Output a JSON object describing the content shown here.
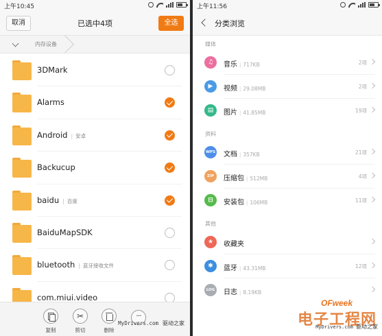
{
  "left": {
    "status": {
      "time": "上午10:45"
    },
    "header": {
      "cancel": "取消",
      "title": "已选中4项",
      "select_all": "全选"
    },
    "breadcrumb": {
      "segment": "内存设备"
    },
    "folders": [
      {
        "name": "3DMark",
        "desc": "",
        "checked": false
      },
      {
        "name": "Alarms",
        "desc": "",
        "checked": true
      },
      {
        "name": "Android",
        "desc": "安卓",
        "checked": true
      },
      {
        "name": "Backucup",
        "desc": "",
        "checked": true
      },
      {
        "name": "baidu",
        "desc": "百度",
        "checked": true
      },
      {
        "name": "BaiduMapSDK",
        "desc": "",
        "checked": false
      },
      {
        "name": "bluetooth",
        "desc": "蓝牙接收文件",
        "checked": false
      },
      {
        "name": "com.miui.video",
        "desc": "",
        "checked": false
      }
    ],
    "actions": {
      "copy": "复制",
      "cut": "剪切",
      "delete": "删除"
    },
    "watermark": {
      "site": "MyDrivers.com",
      "name": "驱动之家"
    }
  },
  "right": {
    "status": {
      "time": "上午11:56"
    },
    "header": {
      "title": "分类浏览"
    },
    "sections": [
      {
        "title": "媒体",
        "items": [
          {
            "name": "音乐",
            "size": "717KB",
            "count": "2项",
            "icon": "music-icon",
            "color": "#ec6f9f",
            "glyph": "♫"
          },
          {
            "name": "视频",
            "size": "29.08MB",
            "count": "2项",
            "icon": "video-icon",
            "color": "#4a9be6",
            "glyph": "▶"
          },
          {
            "name": "图片",
            "size": "41.85MB",
            "count": "19项",
            "icon": "image-icon",
            "color": "#35b98a",
            "glyph": "▤"
          }
        ]
      },
      {
        "title": "资料",
        "items": [
          {
            "name": "文档",
            "size": "357KB",
            "count": "21项",
            "icon": "document-icon",
            "color": "#4d8fe8",
            "glyph": "WPS"
          },
          {
            "name": "压缩包",
            "size": "512MB",
            "count": "4项",
            "icon": "archive-icon",
            "color": "#f0a35e",
            "glyph": "ZIP"
          },
          {
            "name": "安装包",
            "size": "106MB",
            "count": "11项",
            "icon": "apk-icon",
            "color": "#55bb4a",
            "glyph": "⊟"
          }
        ]
      },
      {
        "title": "其他",
        "items": [
          {
            "name": "收藏夹",
            "size": "",
            "count": "",
            "icon": "favorites-icon",
            "color": "#ee6757",
            "glyph": "★"
          },
          {
            "name": "蓝牙",
            "size": "43.31MB",
            "count": "12项",
            "icon": "bluetooth-icon",
            "color": "#3d8fe0",
            "glyph": "✱"
          },
          {
            "name": "日志",
            "size": "8.19KB",
            "count": "",
            "icon": "log-icon",
            "color": "#a9adb3",
            "glyph": "LOG"
          }
        ]
      }
    ],
    "watermark": {
      "site": "MyDrivers.com",
      "name": "驱动之家"
    },
    "logo": {
      "brand": "OFweek",
      "cn": "电子工程网"
    }
  }
}
